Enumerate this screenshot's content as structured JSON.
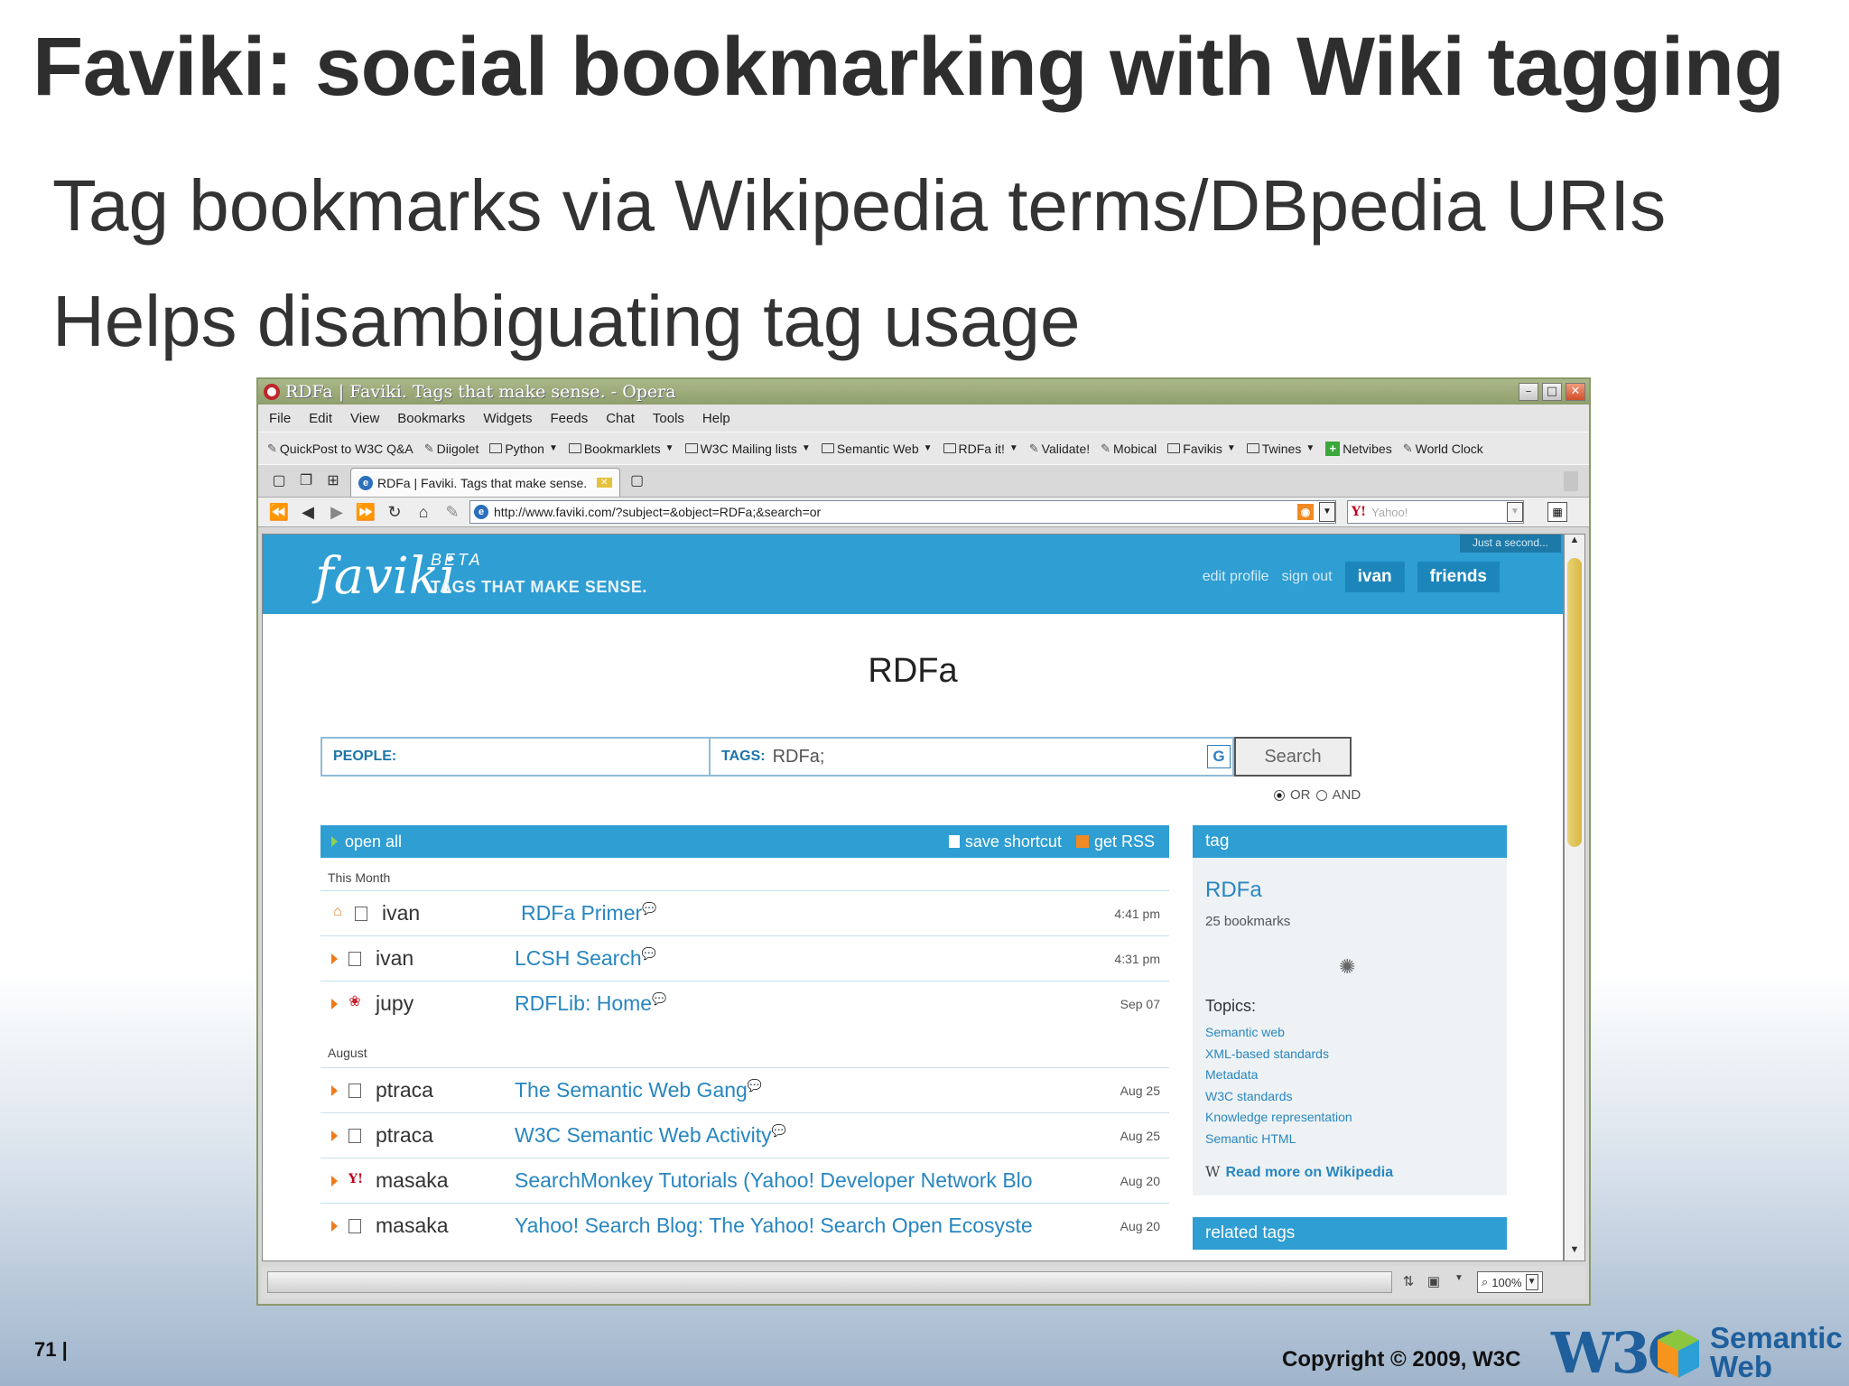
{
  "slide": {
    "title": "Faviki: social bookmarking with Wiki tagging",
    "bullets": [
      "Tag bookmarks via Wikipedia terms/DBpedia URIs",
      "Helps disambiguating tag usage"
    ],
    "page_number": "71 |",
    "copyright": "Copyright © 2009, W3C",
    "logo_text_w3c": "W3C",
    "logo_text_sw": [
      "Semantic",
      "Web"
    ]
  },
  "browser": {
    "window_title": "RDFa | Faviki. Tags that make sense. - Opera",
    "menu": [
      "File",
      "Edit",
      "View",
      "Bookmarks",
      "Widgets",
      "Feeds",
      "Chat",
      "Tools",
      "Help"
    ],
    "bookmarks": [
      {
        "label": "QuickPost to W3C Q&A",
        "kind": "link"
      },
      {
        "label": "Diigolet",
        "kind": "link"
      },
      {
        "label": "Python",
        "kind": "folder"
      },
      {
        "label": "Bookmarklets",
        "kind": "folder"
      },
      {
        "label": "W3C Mailing lists",
        "kind": "folder"
      },
      {
        "label": "Semantic Web",
        "kind": "folder"
      },
      {
        "label": "RDFa it!",
        "kind": "folder"
      },
      {
        "label": "Validate!",
        "kind": "link"
      },
      {
        "label": "Mobical",
        "kind": "link"
      },
      {
        "label": "Favikis",
        "kind": "folder"
      },
      {
        "label": "Twines",
        "kind": "folder"
      },
      {
        "label": "Netvibes",
        "kind": "plus"
      },
      {
        "label": "World Clock",
        "kind": "link"
      }
    ],
    "tab_label": "RDFa | Faviki. Tags that make sense.",
    "url": "http://www.faviki.com/?subject=&object=RDFa;&search=or",
    "search_engine": "Yahoo!",
    "zoom": "100%"
  },
  "faviki": {
    "logo": "faviki",
    "beta": "BETA",
    "slogan": "TAGS THAT MAKE SENSE.",
    "just_a_second": "Just a second...",
    "nav": {
      "edit_profile": "edit profile",
      "sign_out": "sign out",
      "user": "ivan",
      "friends": "friends"
    },
    "page_title": "RDFa",
    "search": {
      "people_label": "PEOPLE:",
      "tags_label": "TAGS:",
      "tags_value": "RDFa;",
      "button": "Search",
      "or": "OR",
      "and": "AND"
    },
    "list_bar": {
      "open_all": "open all",
      "save_shortcut": "save shortcut",
      "get_rss": "get RSS"
    },
    "sections": [
      {
        "label": "This Month",
        "rows": [
          {
            "user": "ivan",
            "title": "RDFa Primer",
            "date": "4:41 pm",
            "icon": "home"
          },
          {
            "user": "ivan",
            "title": "LCSH Search",
            "date": "4:31 pm",
            "icon": "page"
          },
          {
            "user": "jupy",
            "title": "RDFLib: Home",
            "date": "Sep 07",
            "icon": "paw"
          }
        ]
      },
      {
        "label": "August",
        "rows": [
          {
            "user": "ptraca",
            "title": "The Semantic Web Gang",
            "date": "Aug 25",
            "icon": "page"
          },
          {
            "user": "ptraca",
            "title": "W3C Semantic Web Activity",
            "date": "Aug 25",
            "icon": "page"
          },
          {
            "user": "masaka",
            "title": "SearchMonkey Tutorials (Yahoo! Developer Network Blo",
            "date": "Aug 20",
            "icon": "yahoo"
          },
          {
            "user": "masaka",
            "title": "Yahoo! Search Blog: The Yahoo! Search Open Ecosyste",
            "date": "Aug 20",
            "icon": "page"
          }
        ]
      }
    ],
    "tag_panel": {
      "heading": "tag",
      "name": "RDFa",
      "count": "25 bookmarks",
      "topics_heading": "Topics:",
      "topics": [
        "Semantic web",
        "XML-based standards",
        "Metadata",
        "W3C standards",
        "Knowledge representation",
        "Semantic HTML"
      ],
      "read_more": "Read more on Wikipedia"
    },
    "related_tags_heading": "related tags"
  }
}
